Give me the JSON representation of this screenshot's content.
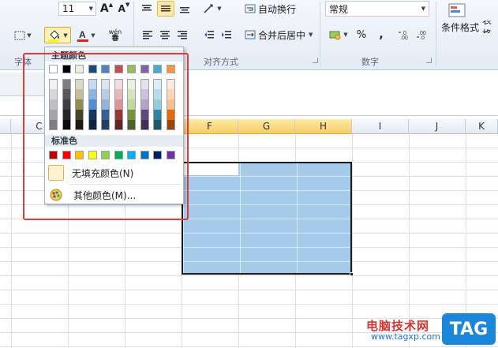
{
  "ribbon": {
    "font_size": "11",
    "number_format": "常规",
    "wrap_text": "自动换行",
    "merge_center": "合并后居中",
    "percent": "%",
    "comma": ",",
    "conditional_format": "条件格式",
    "table_format_partial": "表格",
    "bold_partial": "春",
    "groups": {
      "font": "字体",
      "alignment": "对齐方式",
      "number": "数字"
    }
  },
  "palette": {
    "theme_title": "主题颜色",
    "standard_title": "标准色",
    "no_fill": "无填充颜色(N)",
    "more_colors": "其他颜色(M)...",
    "theme_colors": [
      "#FFFFFF",
      "#000000",
      "#EEECE1",
      "#1F497D",
      "#4F81BD",
      "#C0504D",
      "#9BBB59",
      "#8064A2",
      "#4BACC6",
      "#F79646"
    ],
    "theme_shades": [
      [
        "#F2F2F2",
        "#7F7F7F",
        "#DDD9C3",
        "#C6D9F0",
        "#DBE5F1",
        "#F2DCDB",
        "#EBF1DD",
        "#E5E0EC",
        "#DBEEF3",
        "#FDEADA"
      ],
      [
        "#D8D8D8",
        "#595959",
        "#C4BD97",
        "#8DB3E2",
        "#B8CCE4",
        "#E5B9B7",
        "#D7E3BC",
        "#CCC1D9",
        "#B7DDE8",
        "#FBD5B5"
      ],
      [
        "#BFBFBF",
        "#3F3F3F",
        "#938953",
        "#548DD4",
        "#95B3D7",
        "#D99694",
        "#C3D69B",
        "#B2A2C7",
        "#92CDDC",
        "#FAC08F"
      ],
      [
        "#A5A5A5",
        "#262626",
        "#494429",
        "#17365D",
        "#366092",
        "#953734",
        "#76923C",
        "#5F497A",
        "#31859B",
        "#E36C09"
      ],
      [
        "#7F7F7F",
        "#0C0C0C",
        "#1D1B10",
        "#0F243E",
        "#244061",
        "#632423",
        "#4F6128",
        "#3F3151",
        "#205867",
        "#974806"
      ]
    ],
    "standard_colors": [
      "#C00000",
      "#FF0000",
      "#FFC000",
      "#FFFF00",
      "#92D050",
      "#00B050",
      "#00B0F0",
      "#0070C0",
      "#002060",
      "#7030A0"
    ]
  },
  "columns": [
    "C",
    "D",
    "E",
    "F",
    "G",
    "H",
    "I",
    "J",
    "K"
  ],
  "active_columns": [
    "F",
    "G",
    "H"
  ],
  "watermark": {
    "site_name": "电脑技术网",
    "url": "www.tagxp.com",
    "tag": "TAG"
  }
}
